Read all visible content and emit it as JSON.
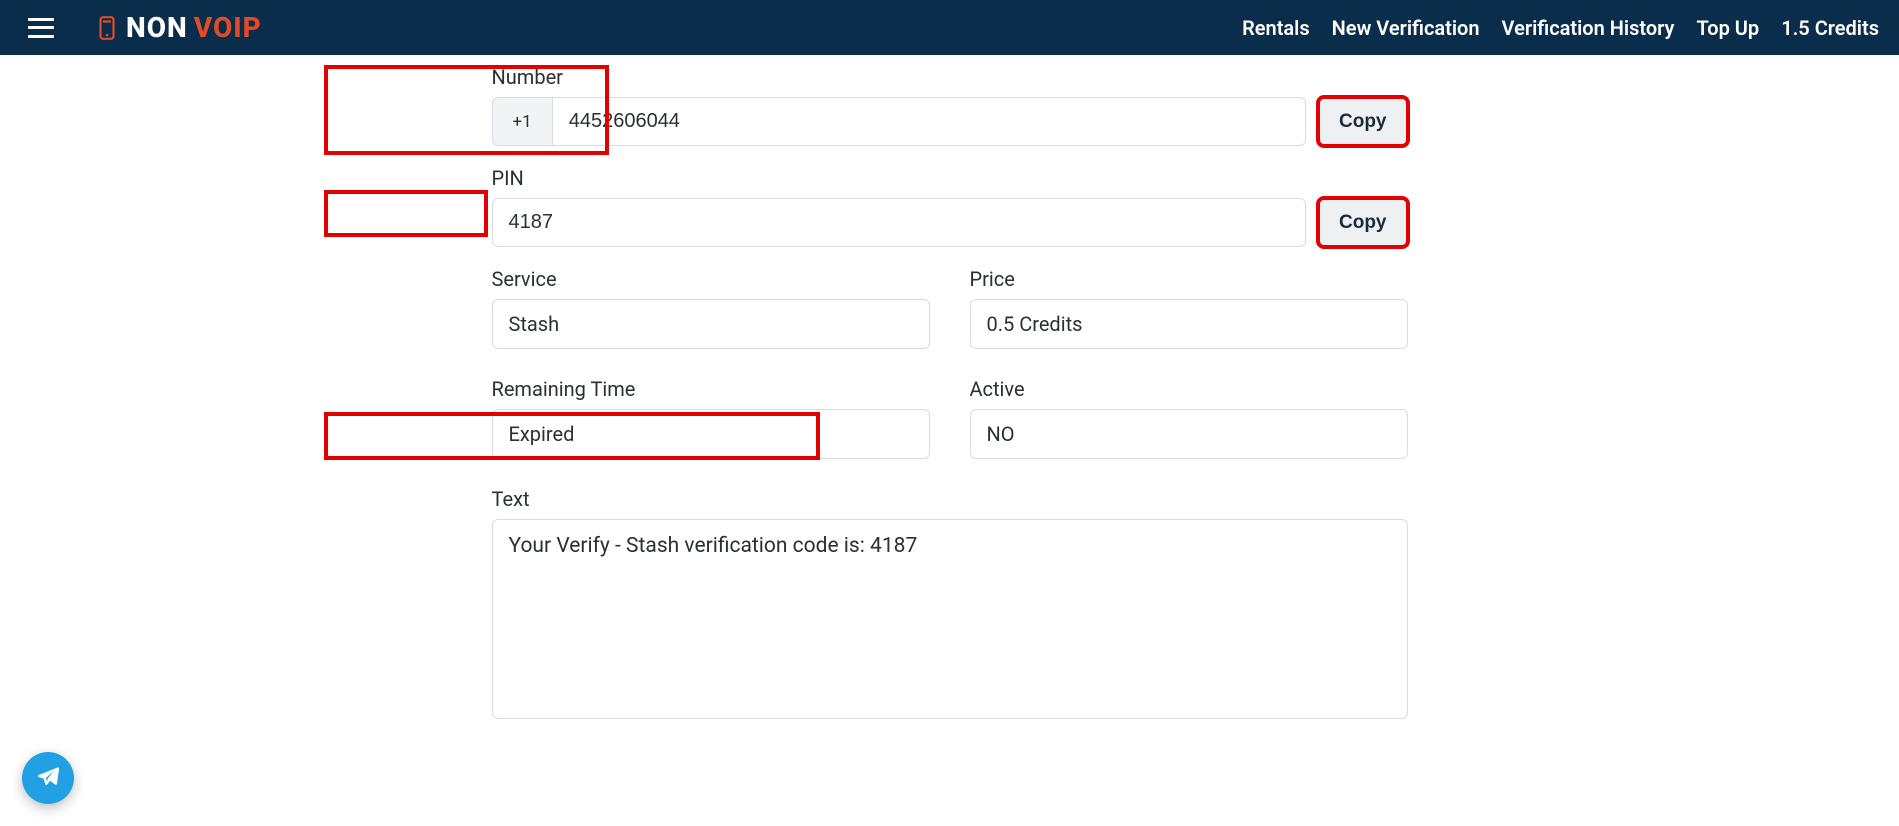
{
  "header": {
    "logo_text_1": "NON",
    "logo_text_2": "VOIP",
    "nav": {
      "rentals": "Rentals",
      "new_verification": "New Verification",
      "verification_history": "Verification History",
      "top_up": "Top Up",
      "credits": "1.5 Credits"
    }
  },
  "fields": {
    "number": {
      "label": "Number",
      "prefix": "+1",
      "value": "4452606044",
      "copy": "Copy"
    },
    "pin": {
      "label": "PIN",
      "value": "4187",
      "copy": "Copy"
    },
    "service": {
      "label": "Service",
      "value": "Stash"
    },
    "price": {
      "label": "Price",
      "value": "0.5 Credits"
    },
    "remaining": {
      "label": "Remaining Time",
      "value": "Expired"
    },
    "active": {
      "label": "Active",
      "value": "NO"
    },
    "text": {
      "label": "Text",
      "value": "Your Verify - Stash verification code is: 4187"
    }
  }
}
